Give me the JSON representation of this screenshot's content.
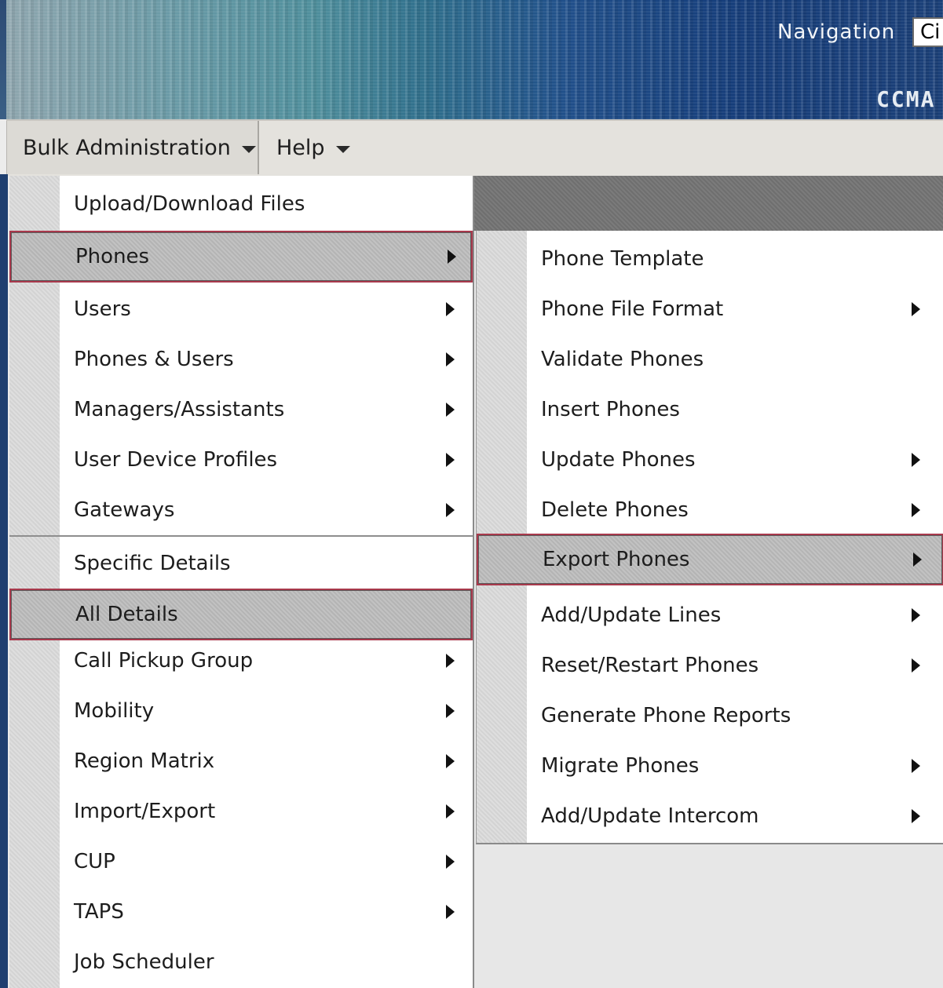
{
  "banner": {
    "navigation_label": "Navigation",
    "navigation_select_value": "Ci",
    "product_label": "CCMA"
  },
  "menubar": {
    "items": [
      {
        "label": "Bulk Administration"
      },
      {
        "label": "Help"
      }
    ]
  },
  "main_menu": {
    "items": [
      {
        "label": "Upload/Download Files",
        "has_submenu": false
      },
      {
        "label": "Phones",
        "has_submenu": true,
        "highlighted": true
      },
      {
        "label": "Users",
        "has_submenu": true
      },
      {
        "label": "Phones & Users",
        "has_submenu": true
      },
      {
        "label": "Managers/Assistants",
        "has_submenu": true
      },
      {
        "label": "User Device Profiles",
        "has_submenu": true
      },
      {
        "label": "Gateways",
        "has_submenu": true
      },
      {
        "label": "Specific Details",
        "has_submenu": false
      },
      {
        "label": "All Details",
        "has_submenu": false,
        "highlighted": true
      },
      {
        "label": "Call Pickup Group",
        "has_submenu": true
      },
      {
        "label": "Mobility",
        "has_submenu": true
      },
      {
        "label": "Region Matrix",
        "has_submenu": true
      },
      {
        "label": "Import/Export",
        "has_submenu": true
      },
      {
        "label": "CUP",
        "has_submenu": true
      },
      {
        "label": "TAPS",
        "has_submenu": true
      },
      {
        "label": "Job Scheduler",
        "has_submenu": false
      }
    ]
  },
  "phones_submenu": {
    "items": [
      {
        "label": "Phone Template",
        "has_submenu": false
      },
      {
        "label": "Phone File Format",
        "has_submenu": true
      },
      {
        "label": "Validate Phones",
        "has_submenu": false
      },
      {
        "label": "Insert Phones",
        "has_submenu": false
      },
      {
        "label": "Update Phones",
        "has_submenu": true
      },
      {
        "label": "Delete Phones",
        "has_submenu": true
      },
      {
        "label": "Export Phones",
        "has_submenu": true,
        "highlighted": true
      },
      {
        "label": "Add/Update Lines",
        "has_submenu": true
      },
      {
        "label": "Reset/Restart Phones",
        "has_submenu": true
      },
      {
        "label": "Generate Phone Reports",
        "has_submenu": false
      },
      {
        "label": "Migrate Phones",
        "has_submenu": true
      },
      {
        "label": "Add/Update Intercom",
        "has_submenu": true
      }
    ]
  },
  "colors": {
    "highlight_border": "#a8394c",
    "menu_background": "#ffffff",
    "banner_accent": "#204f8a"
  }
}
